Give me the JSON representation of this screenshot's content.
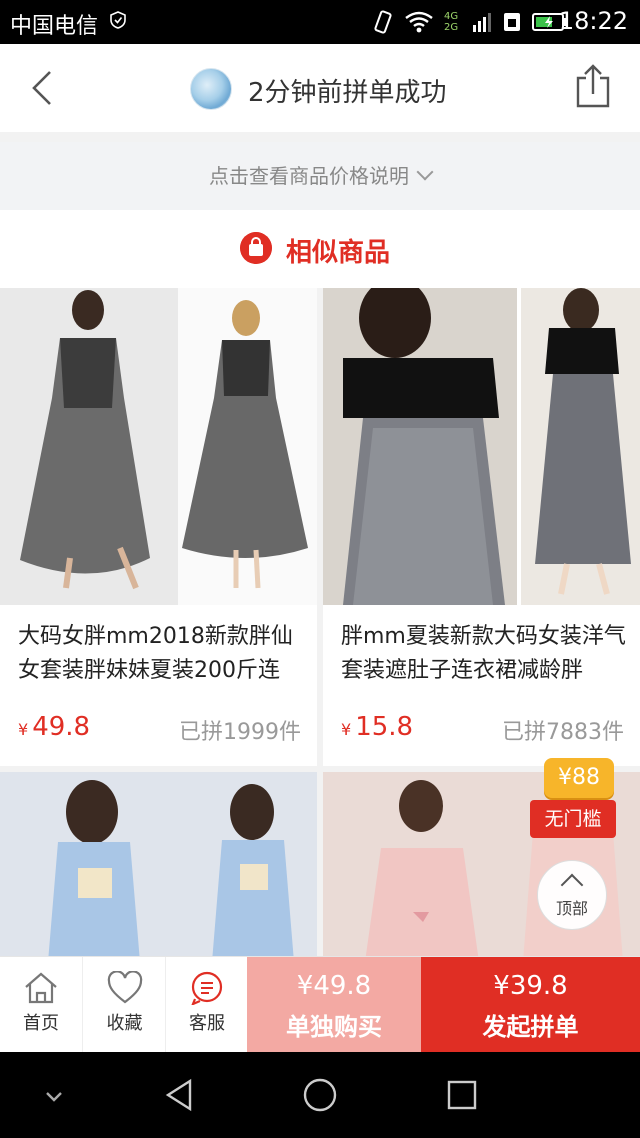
{
  "status_bar": {
    "carrier": "中国电信",
    "network": "4G 2G",
    "time": "18:22"
  },
  "header": {
    "title": "2分钟前拼单成功"
  },
  "price_note": {
    "text": "点击查看商品价格说明"
  },
  "similar": {
    "heading": "相似商品"
  },
  "products": [
    {
      "name": "大码女胖mm2018新款胖仙女套装胖妹妹夏装200斤连",
      "currency": "¥",
      "price": "49.8",
      "sold": "已拼1999件"
    },
    {
      "name": "胖mm夏装新款大码女装洋气套装遮肚子连衣裙减龄胖",
      "currency": "¥",
      "price": "15.8",
      "sold": "已拼7883件"
    },
    {
      "name": "",
      "currency": "",
      "price": "",
      "sold": ""
    },
    {
      "name": "",
      "currency": "",
      "price": "",
      "sold": ""
    }
  ],
  "promo": {
    "amount": "¥88",
    "label": "无门槛"
  },
  "back_to_top": {
    "label": "顶部"
  },
  "bottom_bar": {
    "home": "首页",
    "favorite": "收藏",
    "service": "客服",
    "buy_alone_price": "¥49.8",
    "buy_alone_label": "单独购买",
    "group_price": "¥39.8",
    "group_label": "发起拼单"
  },
  "colors": {
    "accent": "#e02e24",
    "buy_alone": "#f3a9a3"
  }
}
